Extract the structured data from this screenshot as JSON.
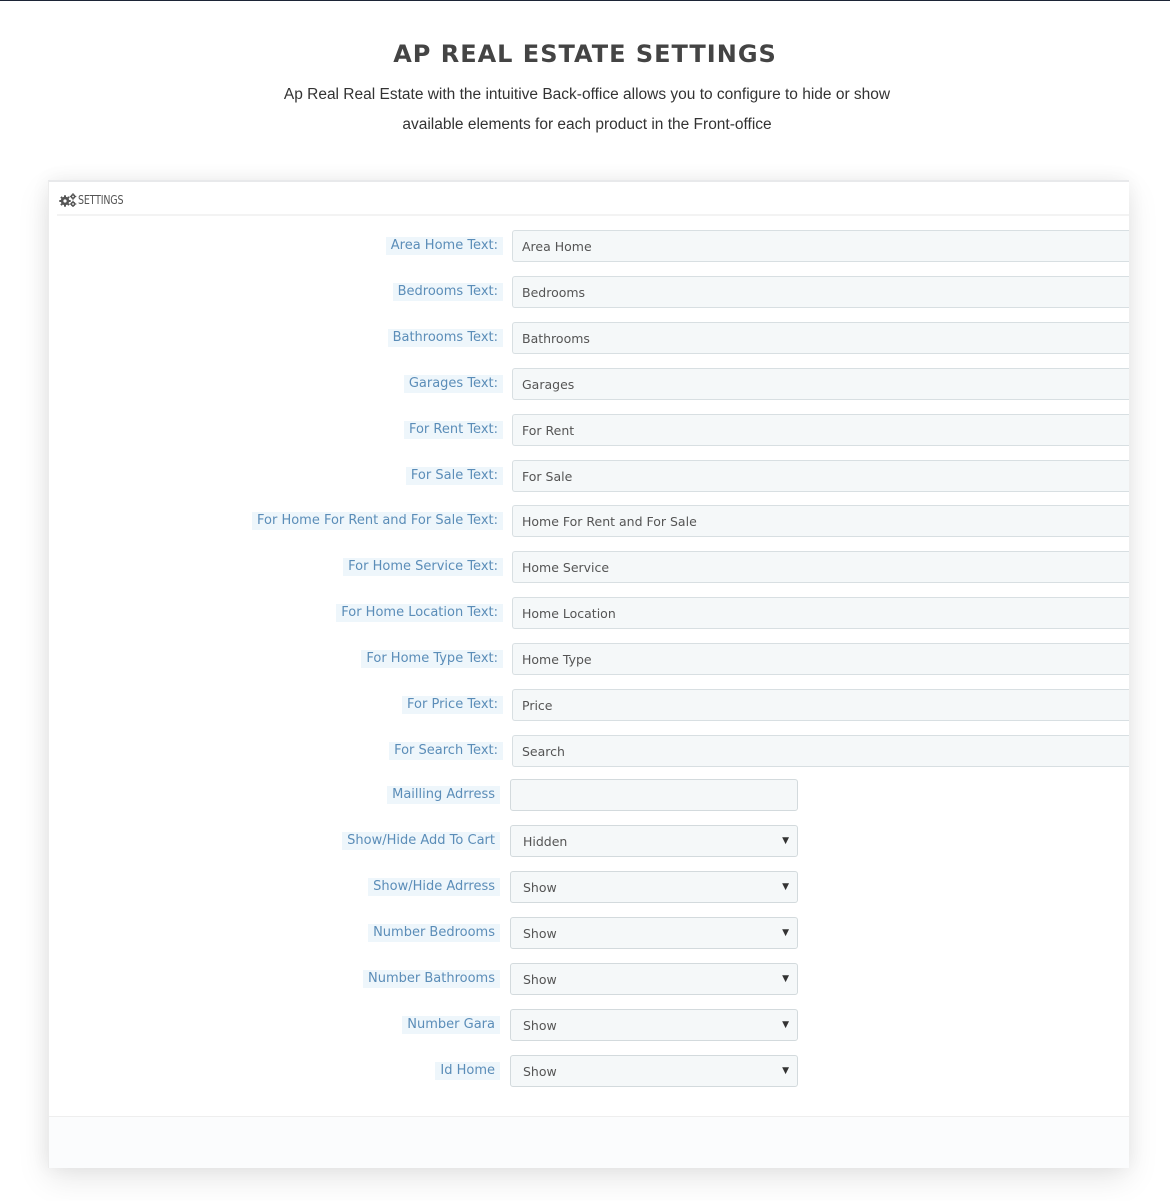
{
  "header": {
    "title": "AP REAL ESTATE SETTINGS",
    "subtitle_line1": "Ap Real Real Estate with the intuitive Back-office allows you to configure to hide or show",
    "subtitle_line2": "available elements for each product in the Front-office"
  },
  "panel": {
    "heading_icon": "gears-icon",
    "heading": "SETTINGS"
  },
  "text_fields": [
    {
      "label": "Area Home Text:",
      "value": "Area Home"
    },
    {
      "label": "Bedrooms Text:",
      "value": "Bedrooms"
    },
    {
      "label": "Bathrooms Text:",
      "value": "Bathrooms"
    },
    {
      "label": "Garages Text:",
      "value": "Garages"
    },
    {
      "label": "For Rent Text:",
      "value": "For Rent"
    },
    {
      "label": "For Sale Text:",
      "value": "For Sale"
    },
    {
      "label": "For Home For Rent and For Sale Text:",
      "value": "Home For Rent and For Sale"
    },
    {
      "label": "For Home Service Text:",
      "value": "Home Service"
    },
    {
      "label": "For Home Location Text:",
      "value": "Home Location"
    },
    {
      "label": "For Home Type Text:",
      "value": "Home Type"
    },
    {
      "label": "For Price Text:",
      "value": "Price"
    },
    {
      "label": "For Search Text:",
      "value": "Search"
    }
  ],
  "mailing_address": {
    "label": "Mailling Adrress",
    "value": ""
  },
  "select_fields": [
    {
      "label": "Show/Hide Add To Cart",
      "value": "Hidden"
    },
    {
      "label": "Show/Hide Adrress",
      "value": "Show"
    },
    {
      "label": "Number Bedrooms",
      "value": "Show"
    },
    {
      "label": "Number Bathrooms",
      "value": "Show"
    },
    {
      "label": "Number Gara",
      "value": "Show"
    },
    {
      "label": "Id Home",
      "value": "Show"
    }
  ],
  "icons": {
    "caret": "▼"
  },
  "colors": {
    "label_text": "#5b8db8",
    "label_bg": "#eef6fb",
    "input_bg": "#f5f8f9",
    "title": "#444444"
  }
}
